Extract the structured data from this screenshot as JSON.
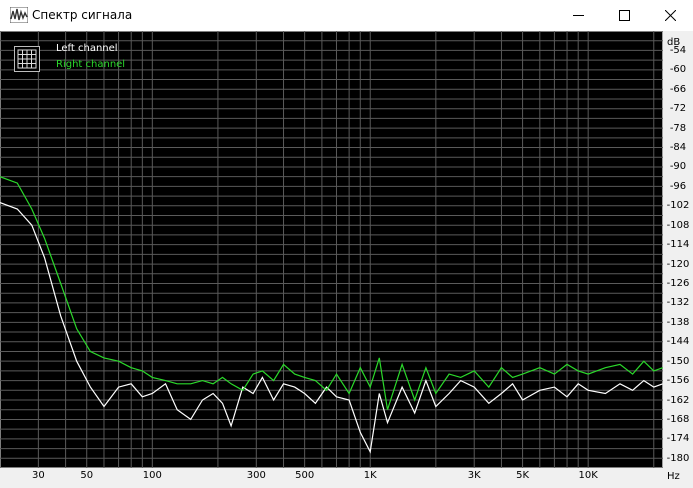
{
  "window": {
    "title": "Спектр сигнала"
  },
  "legend": {
    "left_label": "Left channel",
    "right_label": "Right channel",
    "left_color": "#ffffff",
    "right_color": "#2bd92b"
  },
  "axes": {
    "y_unit": "dB",
    "x_unit": "Hz",
    "y_ticks": [
      "-54",
      "-60",
      "-66",
      "-72",
      "-78",
      "-84",
      "-90",
      "-96",
      "-102",
      "-108",
      "-114",
      "-120",
      "-126",
      "-132",
      "-138",
      "-144",
      "-150",
      "-156",
      "-162",
      "-168",
      "-174",
      "-180"
    ],
    "x_ticks": [
      "30",
      "50",
      "100",
      "300",
      "500",
      "1K",
      "3K",
      "5K",
      "10K"
    ]
  },
  "chart_data": {
    "type": "line",
    "x_scale": "log",
    "xlabel": "Hz",
    "ylabel": "dB",
    "xlim": [
      20,
      22050
    ],
    "ylim": [
      -183,
      -48
    ],
    "grid": true,
    "legend_position": "top-left",
    "series": [
      {
        "name": "Left channel",
        "color": "#ffffff",
        "x": [
          20,
          24,
          28,
          32,
          38,
          45,
          52,
          60,
          70,
          80,
          90,
          100,
          115,
          130,
          150,
          170,
          190,
          210,
          230,
          260,
          290,
          320,
          360,
          400,
          450,
          500,
          560,
          630,
          700,
          800,
          900,
          1000,
          1100,
          1200,
          1400,
          1600,
          1800,
          2000,
          2300,
          2600,
          3000,
          3500,
          4000,
          4500,
          5000,
          6000,
          7000,
          8000,
          9000,
          10000,
          12000,
          14000,
          16000,
          18000,
          20000,
          22000
        ],
        "y": [
          -101,
          -103,
          -108,
          -118,
          -136,
          -150,
          -158,
          -164,
          -158,
          -157,
          -161,
          -160,
          -157,
          -165,
          -168,
          -162,
          -160,
          -163,
          -170,
          -158,
          -160,
          -155,
          -162,
          -157,
          -158,
          -160,
          -163,
          -158,
          -161,
          -162,
          -172,
          -178,
          -160,
          -169,
          -158,
          -166,
          -156,
          -164,
          -160,
          -156,
          -158,
          -163,
          -160,
          -157,
          -162,
          -159,
          -158,
          -161,
          -157,
          -159,
          -160,
          -157,
          -159,
          -156,
          -158,
          -157
        ]
      },
      {
        "name": "Right channel",
        "color": "#2bd92b",
        "x": [
          20,
          24,
          28,
          32,
          38,
          45,
          52,
          60,
          70,
          80,
          90,
          100,
          115,
          130,
          150,
          170,
          190,
          210,
          230,
          260,
          290,
          320,
          360,
          400,
          450,
          500,
          560,
          630,
          700,
          800,
          900,
          1000,
          1100,
          1200,
          1400,
          1600,
          1800,
          2000,
          2300,
          2600,
          3000,
          3500,
          4000,
          4500,
          5000,
          6000,
          7000,
          8000,
          9000,
          10000,
          12000,
          14000,
          16000,
          18000,
          20000,
          22000
        ],
        "y": [
          -93,
          -95,
          -103,
          -112,
          -126,
          -140,
          -147,
          -149,
          -150,
          -152,
          -153,
          -155,
          -156,
          -157,
          -157,
          -156,
          -157,
          -155,
          -157,
          -159,
          -154,
          -153,
          -156,
          -151,
          -154,
          -155,
          -156,
          -159,
          -154,
          -160,
          -152,
          -158,
          -149,
          -165,
          -151,
          -162,
          -152,
          -160,
          -154,
          -155,
          -153,
          -158,
          -152,
          -155,
          -154,
          -152,
          -154,
          -151,
          -153,
          -154,
          -152,
          -151,
          -154,
          -150,
          -153,
          -152
        ]
      }
    ]
  }
}
